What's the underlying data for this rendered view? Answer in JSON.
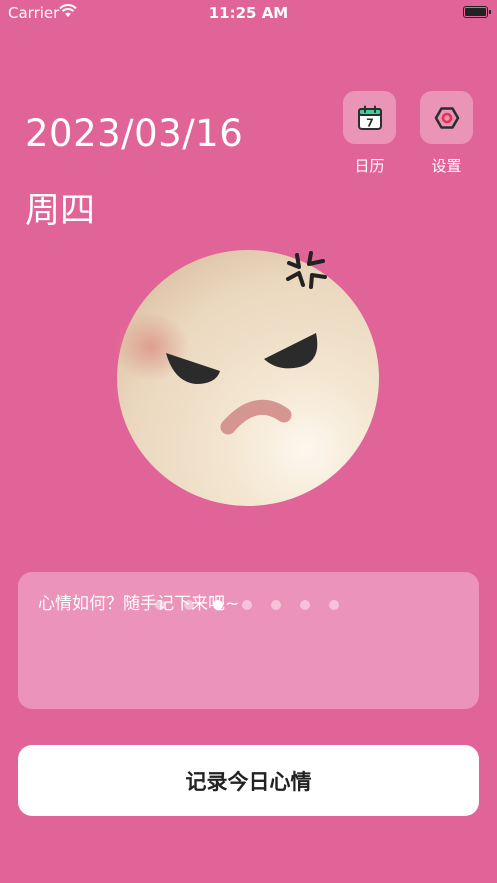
{
  "status_bar": {
    "carrier": "Carrier",
    "time": "11:25 AM"
  },
  "header": {
    "date": "2023/03/16",
    "weekday": "周四"
  },
  "actions": [
    {
      "label": "日历",
      "icon": "calendar-icon",
      "icon_number": "7"
    },
    {
      "label": "设置",
      "icon": "settings-icon"
    }
  ],
  "mood": {
    "icon": "angry-face-icon",
    "page_count": 7,
    "active_page": 3
  },
  "note": {
    "placeholder": "心情如何？随手记下来吧~"
  },
  "record_button": {
    "label": "记录今日心情"
  },
  "colors": {
    "background": "#e06497",
    "panel": "#eb93b8",
    "button": "#ffffff"
  }
}
